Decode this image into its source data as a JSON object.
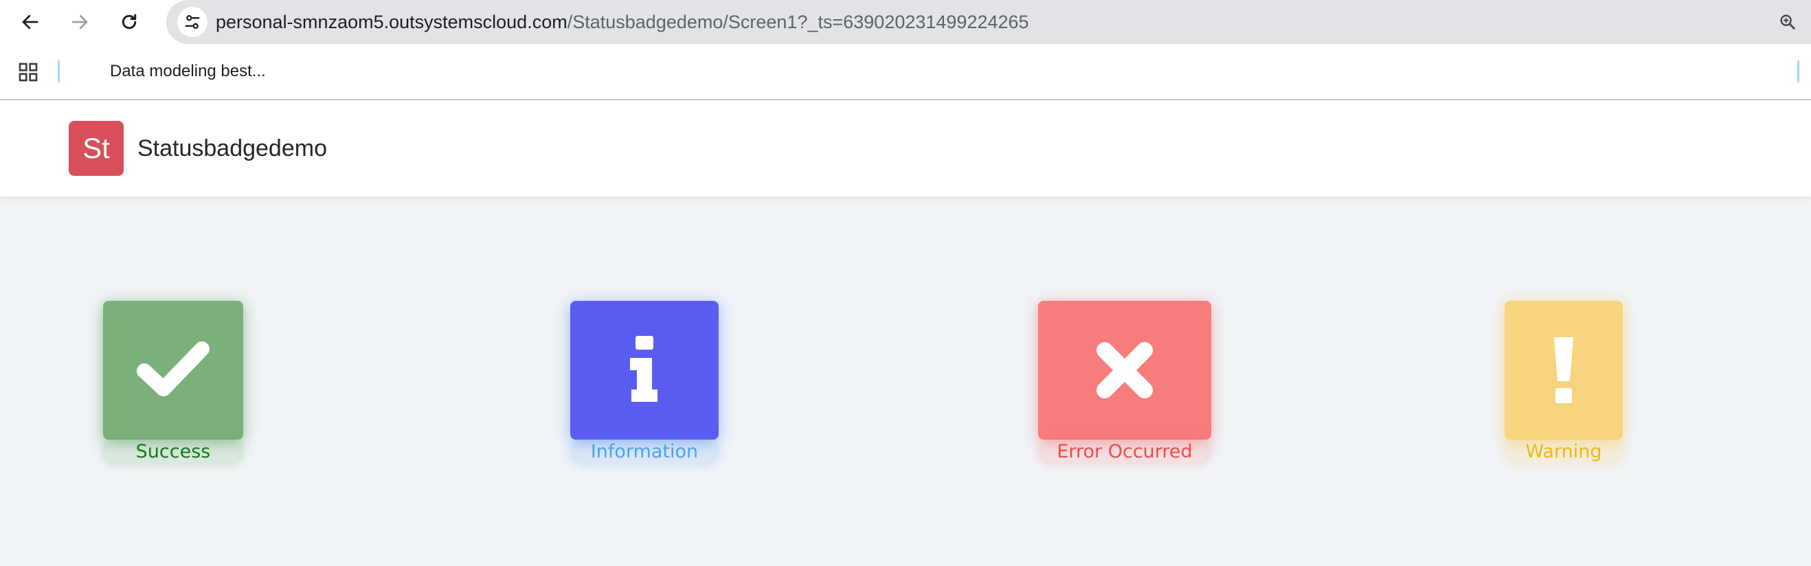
{
  "browser": {
    "url_host": "personal-smnzaom5.outsystemscloud.com",
    "url_path": "/Statusbadgedemo/Screen1?_ts=639020231499224265",
    "icons": {
      "back": "arrow-left-icon",
      "forward": "arrow-right-icon",
      "reload": "reload-icon",
      "site_info": "tune-icon",
      "zoom": "zoom-in-icon",
      "apps": "apps-grid-icon"
    }
  },
  "bookmarks": {
    "items": [
      {
        "label": "Data modeling best..."
      }
    ]
  },
  "app": {
    "logo_text": "St",
    "title": "Statusbadgedemo",
    "logo_color": "#d84e5a"
  },
  "badges": [
    {
      "label": "Success",
      "icon": "checkmark-icon",
      "box_color": "#7bb07b",
      "text_color": "#127d12"
    },
    {
      "label": "Information",
      "icon": "info-icon",
      "box_color": "#5b5cf2",
      "text_color": "#4aa3f2"
    },
    {
      "label": "Error Occurred",
      "icon": "close-icon",
      "box_color": "#f77c7c",
      "text_color": "#ef4b4b"
    },
    {
      "label": "Warning",
      "icon": "exclamation-icon",
      "box_color": "#f6d57e",
      "text_color": "#f3b714"
    }
  ]
}
